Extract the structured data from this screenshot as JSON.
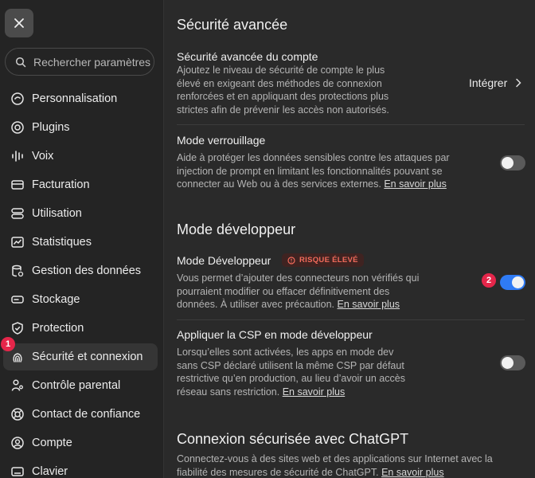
{
  "sidebar": {
    "search_placeholder": "Rechercher paramètres",
    "items": [
      {
        "label": "Personnalisation",
        "icon": "personalization-icon"
      },
      {
        "label": "Plugins",
        "icon": "plugins-icon"
      },
      {
        "label": "Voix",
        "icon": "voice-waveform-icon"
      },
      {
        "label": "Facturation",
        "icon": "credit-card-icon"
      },
      {
        "label": "Utilisation",
        "icon": "usage-bars-icon"
      },
      {
        "label": "Statistiques",
        "icon": "chart-icon"
      },
      {
        "label": "Gestion des données",
        "icon": "database-icon"
      },
      {
        "label": "Stockage",
        "icon": "storage-drive-icon"
      },
      {
        "label": "Protection",
        "icon": "shield-icon"
      },
      {
        "label": "Sécurité et connexion",
        "icon": "fingerprint-icon"
      },
      {
        "label": "Contrôle parental",
        "icon": "parental-icon"
      },
      {
        "label": "Contact de confiance",
        "icon": "lifebuoy-icon"
      },
      {
        "label": "Compte",
        "icon": "account-icon"
      },
      {
        "label": "Clavier",
        "icon": "keyboard-icon"
      }
    ],
    "active_item": "Sécurité et connexion",
    "marker_1": "1"
  },
  "main": {
    "advanced_security": {
      "title": "Sécurité avancée",
      "account_title": "Sécurité avancée du compte",
      "account_desc": "Ajoutez le niveau de sécurité de compte le plus élevé en exigeant des méthodes de connexion renforcées et en appliquant des protections plus strictes afin de prévenir les accès non autorisés.",
      "integrate_label": "Intégrer",
      "lockdown_title": "Mode verrouillage",
      "lockdown_desc": "Aide à protéger les données sensibles contre les attaques par injection de prompt en limitant les fonctionnalités pouvant se connecter au Web ou à des services externes.",
      "lockdown_link": "En savoir plus",
      "lockdown_enabled": false
    },
    "developer": {
      "title": "Mode développeur",
      "dev_title": "Mode Développeur",
      "risk_badge": "RISQUE ÉLEVÉ",
      "dev_desc": "Vous permet d’ajouter des connecteurs non vérifiés qui pourraient modifier ou effacer définitivement des données. À utiliser avec précaution.",
      "dev_link": "En savoir plus",
      "dev_enabled": true,
      "marker_2": "2",
      "csp_title": "Appliquer la CSP en mode développeur",
      "csp_desc": "Lorsqu’elles sont activées, les apps en mode dev sans CSP déclaré utilisent la même CSP par défaut restrictive qu’en production, au lieu d’avoir un accès réseau sans restriction.",
      "csp_link": "En savoir plus",
      "csp_enabled": false
    },
    "chatgpt_login": {
      "title": "Connexion sécurisée avec ChatGPT",
      "desc": "Connectez-vous à des sites web et des applications sur Internet avec la fiabilité des mesures de sécurité de ChatGPT.",
      "link": "En savoir plus"
    }
  },
  "colors": {
    "accent": "#2f7bf5",
    "badge": "#e5264a",
    "risk": "#f26b5b"
  }
}
